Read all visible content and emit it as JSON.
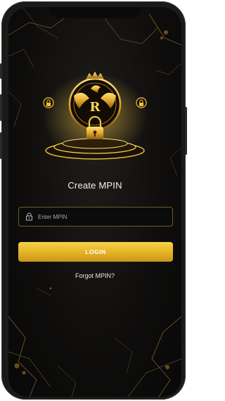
{
  "screen": {
    "title": "Create MPIN",
    "mpin_input": {
      "placeholder": "Enter MPIN",
      "value": "",
      "icon": "lock-icon"
    },
    "login_label": "LOGIN",
    "forgot_label": "Forgot MPIN?",
    "emblem": {
      "icons": [
        "eagle-crest-icon",
        "crown-icon",
        "padlock-icon",
        "lock-badge-icon"
      ],
      "accent_color": "#f0c03a"
    }
  }
}
